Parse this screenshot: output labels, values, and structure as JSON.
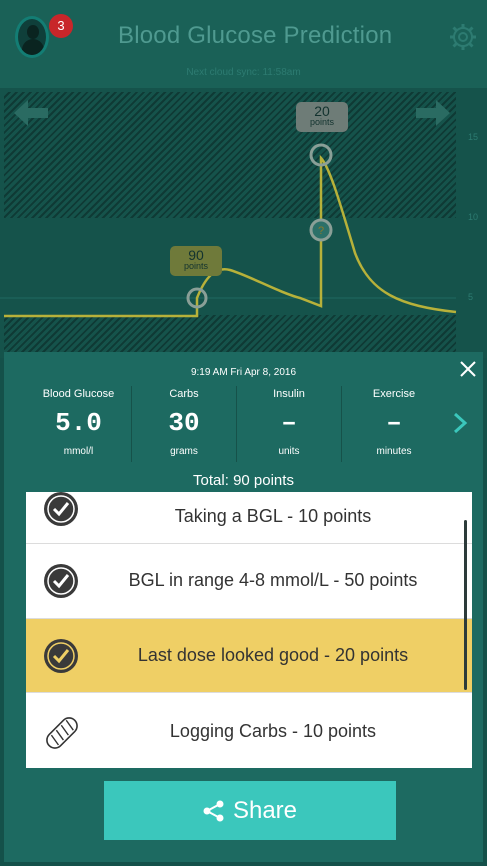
{
  "header": {
    "title": "Blood Glucose Prediction",
    "badge_count": "3",
    "sync_text": "Next cloud sync: 11:58am"
  },
  "chart": {
    "yticks": [
      "15",
      "10",
      "5"
    ],
    "bubble_low": {
      "value": "90",
      "unit": "points"
    },
    "bubble_high": {
      "value": "20",
      "unit": "points"
    }
  },
  "panel": {
    "datetime": "9:19 AM Fri Apr 8, 2016",
    "stats": [
      {
        "label": "Blood Glucose",
        "value": "5.0",
        "unit": "mmol/l"
      },
      {
        "label": "Carbs",
        "value": "30",
        "unit": "grams"
      },
      {
        "label": "Insulin",
        "value": "–",
        "unit": "units"
      },
      {
        "label": "Exercise",
        "value": "–",
        "unit": "minutes"
      }
    ],
    "total": "Total: 90 points",
    "items": [
      {
        "text": "Taking a BGL - 10 points",
        "icon": "check-circle-icon",
        "highlighted": false
      },
      {
        "text": "BGL in range 4-8 mmol/L - 50 points",
        "icon": "check-circle-icon",
        "highlighted": false
      },
      {
        "text": "Last dose looked good - 20 points",
        "icon": "check-circle-icon",
        "highlighted": true
      },
      {
        "text": "Logging Carbs - 10 points",
        "icon": "bread-icon",
        "highlighted": false
      }
    ],
    "share_label": "Share"
  },
  "colors": {
    "accent": "#3bc7bc",
    "highlight": "#efcf65",
    "panel": "#1d6a61",
    "badge": "#c8262a",
    "curve": "#b7b13a"
  }
}
